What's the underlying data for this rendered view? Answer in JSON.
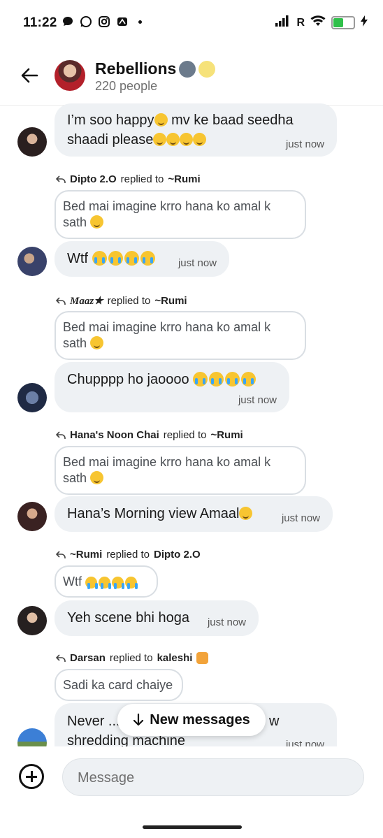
{
  "status": {
    "time": "11:22",
    "carrier": "R"
  },
  "header": {
    "title": "Rebellions",
    "subtitle": "220 people"
  },
  "messages": [
    {
      "line1": "I’m soo happy",
      "line1b": " mv ke baad seedha",
      "line2": "shaadi please",
      "time": "just now"
    },
    {
      "reply_by": "Dipto 2.O",
      "reply_to": "~Rumi",
      "quote_l1": "Bed mai imagine krro hana ko amal k",
      "quote_l2": "sath",
      "text": "Wtf",
      "time": "just now"
    },
    {
      "reply_by": "Maaz★",
      "reply_to": "~Rumi",
      "quote_l1": "Bed mai imagine krro hana ko amal k",
      "quote_l2": "sath",
      "text": "Chupppp ho jaoooo",
      "time": "just now"
    },
    {
      "reply_by": "Hana's Noon Chai",
      "reply_to": "~Rumi",
      "quote_l1": "Bed mai imagine krro hana ko amal k",
      "quote_l2": "sath",
      "text": "Hana’s Morning view Amaal",
      "time": "just now"
    },
    {
      "reply_by": "~Rumi",
      "reply_to": "Dipto 2.O",
      "quote_l1": "Wtf",
      "text": "Yeh scene bhi hoga",
      "time": "just now"
    },
    {
      "reply_by": "Darsan",
      "reply_to": "kaleshi",
      "quote_l1": "Sadi ka card chaiye",
      "line1": "Never ...",
      "line1b": "w",
      "line2": "shredding machine",
      "time": "just now"
    }
  ],
  "labels": {
    "replied_to": "replied to"
  },
  "new_messages": "New messages",
  "composer": {
    "placeholder": "Message"
  },
  "colors": {
    "bubble": "#eef1f4",
    "quote_border": "#d9dee3",
    "accent": "#111111"
  }
}
